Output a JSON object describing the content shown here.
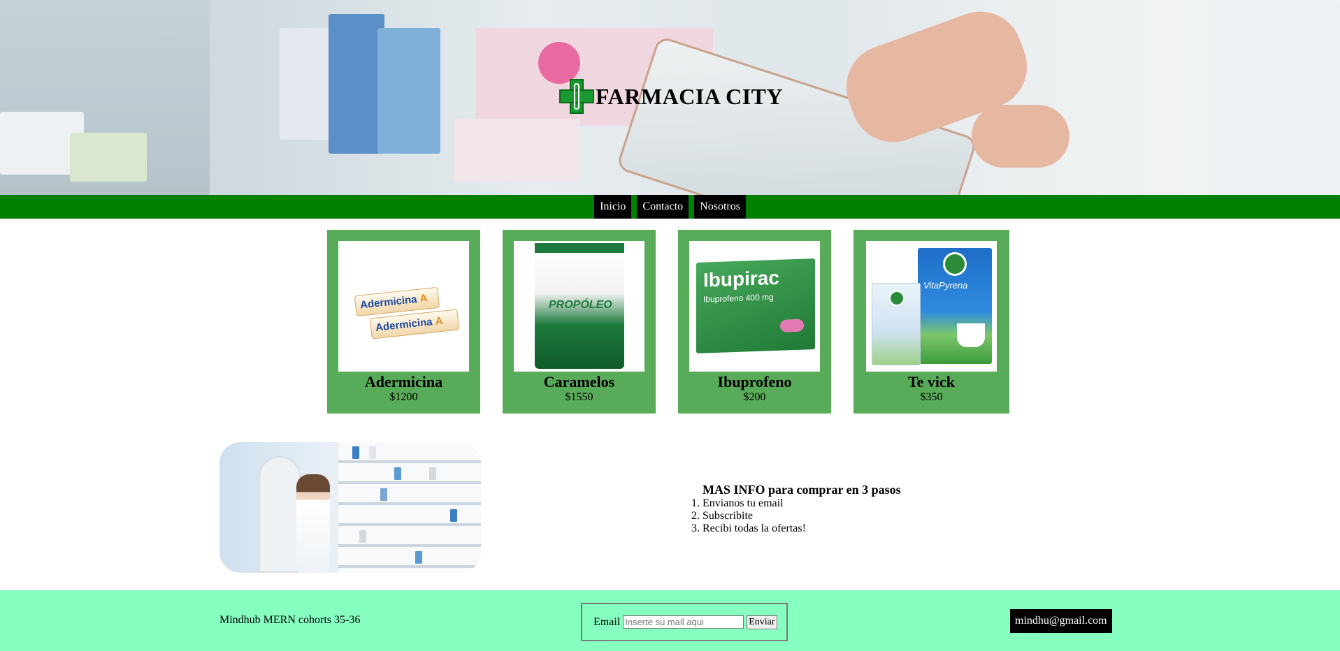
{
  "header": {
    "brand_title": "FARMACIA CITY",
    "logo_icon": "pharmacy-cross-icon"
  },
  "nav": {
    "items": [
      {
        "label": "Inicio"
      },
      {
        "label": "Contacto"
      },
      {
        "label": "Nosotros"
      }
    ]
  },
  "products": [
    {
      "name": "Adermicina",
      "price": "$1200",
      "image_text": "Adermicina",
      "image_suffix": "A"
    },
    {
      "name": "Caramelos",
      "price": "$1550",
      "image_text": "PROPÓLEO"
    },
    {
      "name": "Ibuprofeno",
      "price": "$200",
      "image_text": "Ibupirac",
      "image_sub": "Ibuprofeno 400 mg"
    },
    {
      "name": "Te vick",
      "price": "$350",
      "image_text": "VitaPyrena"
    }
  ],
  "info": {
    "title": "MAS INFO para comprar en 3 pasos",
    "steps": [
      "Envianos tu email",
      "Subscribite",
      "Recibi todas la ofertas!"
    ]
  },
  "footer": {
    "credit": "Mindhub MERN cohorts 35-36",
    "email_label": "Email",
    "email_placeholder": "Inserte su mail aqui",
    "submit_label": "Enviar",
    "contact_email": "mindhu@gmail.com"
  },
  "colors": {
    "nav_bg": "#008000",
    "card_bg": "#58ab58",
    "footer_bg": "#86ffc0"
  }
}
